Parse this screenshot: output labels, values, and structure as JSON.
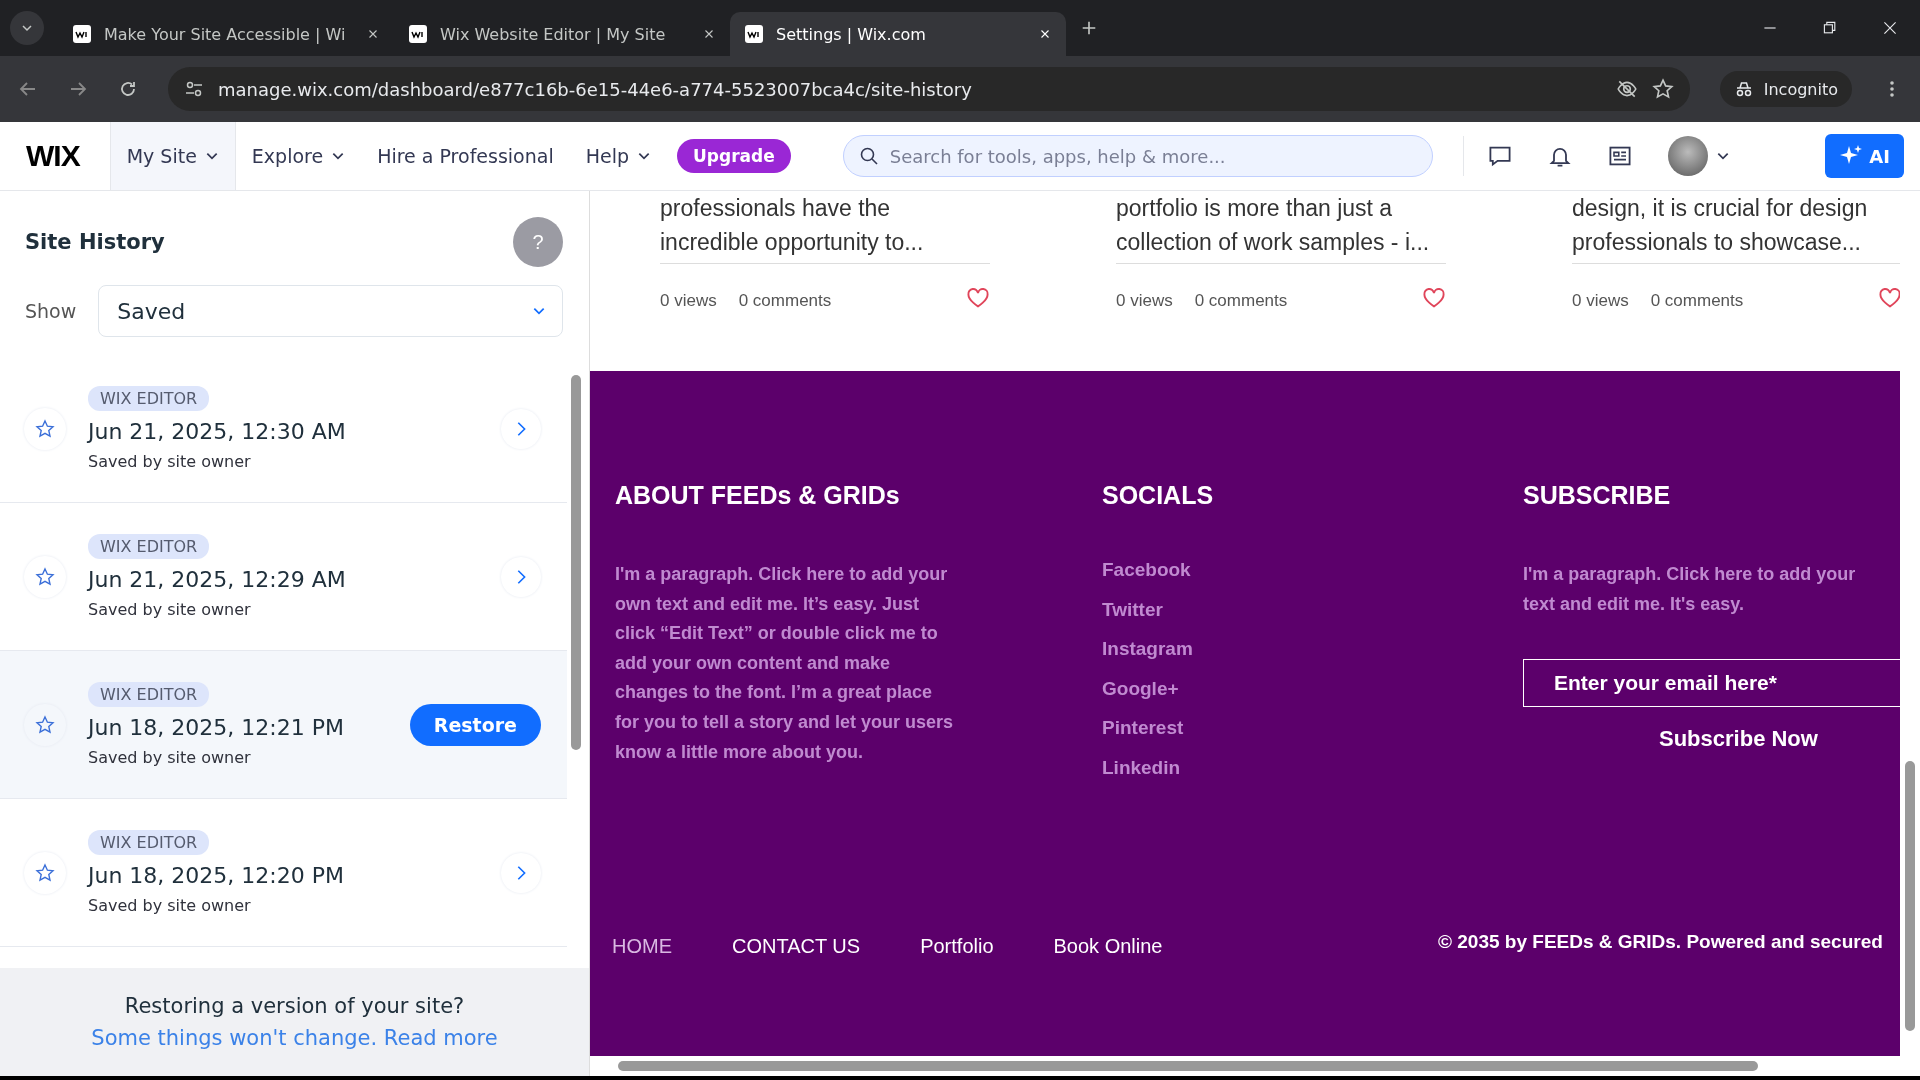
{
  "browser": {
    "tabs": [
      {
        "title": "Make Your Site Accessible | Wi",
        "selected": false
      },
      {
        "title": "Wix Website Editor | My Site",
        "selected": false
      },
      {
        "title": "Settings | Wix.com",
        "selected": true
      }
    ],
    "address": "manage.wix.com/dashboard/e877c16b-6e15-44e6-a774-5523007bca4c/site-history",
    "profile": "Incognito"
  },
  "header": {
    "logo": "WIX",
    "nav": [
      {
        "label": "My Site",
        "dropdown": true,
        "selected": true
      },
      {
        "label": "Explore",
        "dropdown": true,
        "selected": false
      },
      {
        "label": "Hire a Professional",
        "dropdown": false,
        "selected": false
      },
      {
        "label": "Help",
        "dropdown": true,
        "selected": false
      }
    ],
    "upgrade": "Upgrade",
    "search": {
      "placeholder": "Search for tools, apps, help & more..."
    },
    "ai": "AI"
  },
  "site_history": {
    "title": "Site History",
    "help": "?",
    "show_label": "Show",
    "show_value": "Saved",
    "versions": [
      {
        "source": "WIX EDITOR",
        "date": "Jun 21, 2025, 12:30 AM",
        "saved_by": "Saved by site owner",
        "selected": false
      },
      {
        "source": "WIX EDITOR",
        "date": "Jun 21, 2025, 12:29 AM",
        "saved_by": "Saved by site owner",
        "selected": false
      },
      {
        "source": "WIX EDITOR",
        "date": "Jun 18, 2025, 12:21 PM",
        "saved_by": "Saved by site owner",
        "selected": true
      },
      {
        "source": "WIX EDITOR",
        "date": "Jun 18, 2025, 12:20 PM",
        "saved_by": "Saved by site owner",
        "selected": false
      }
    ],
    "restore": "Restore",
    "note": "Restoring a version of your site?",
    "link": "Some things won't change. Read more"
  },
  "preview": {
    "posts": [
      {
        "lines": [
          "professionals have the",
          "incredible opportunity to..."
        ],
        "views": "0 views",
        "comments": "0 comments"
      },
      {
        "lines": [
          "portfolio is more than just a",
          "collection of work samples - i..."
        ],
        "views": "0 views",
        "comments": "0 comments"
      },
      {
        "lines": [
          "design, it is crucial for design",
          "professionals to showcase..."
        ],
        "views": "0 views",
        "comments": "0 comments"
      }
    ],
    "about": {
      "title": "ABOUT FEEDs & GRIDs",
      "lines": [
        "I'm a paragraph. Click here to add your",
        "own text and edit me. It’s easy. Just",
        "click “Edit Text” or double click me to",
        "add your own content and make",
        "changes to the font. I’m a great place",
        "for you to tell a story and let your users",
        "know a little more about you."
      ]
    },
    "socials": {
      "title": "SOCIALS",
      "links": [
        "Facebook",
        "Twitter",
        "Instagram",
        "Google+",
        "Pinterest",
        "Linkedin"
      ]
    },
    "subscribe": {
      "title": "SUBSCRIBE",
      "lines": [
        "I'm a paragraph. Click here to add your",
        "text and edit me. It's easy."
      ],
      "email_placeholder": "Enter your email here*",
      "button": "Subscribe Now"
    },
    "menu": [
      {
        "label": "HOME",
        "selected": true
      },
      {
        "label": "CONTACT US",
        "selected": false
      },
      {
        "label": "Portfolio",
        "selected": false
      },
      {
        "label": "Book Online",
        "selected": false
      }
    ],
    "copyright": "© 2035 by FEEDs & GRIDs. Powered and secured"
  }
}
